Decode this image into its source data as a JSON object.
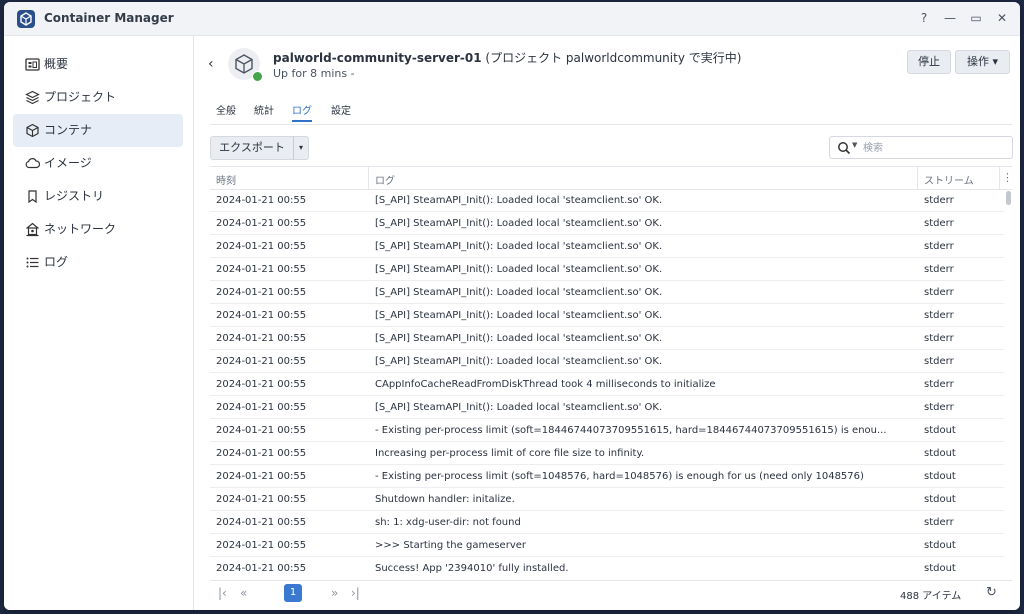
{
  "app": {
    "title": "Container Manager"
  },
  "window_controls": {
    "help": "?",
    "minimize": "—",
    "maximize": "▭",
    "close": "✕"
  },
  "sidebar": {
    "items": [
      {
        "label": "概要",
        "icon": "overview-icon"
      },
      {
        "label": "プロジェクト",
        "icon": "project-icon"
      },
      {
        "label": "コンテナ",
        "icon": "container-icon",
        "active": true
      },
      {
        "label": "イメージ",
        "icon": "image-icon"
      },
      {
        "label": "レジストリ",
        "icon": "registry-icon"
      },
      {
        "label": "ネットワーク",
        "icon": "network-icon"
      },
      {
        "label": "ログ",
        "icon": "log-icon"
      }
    ]
  },
  "container": {
    "name": "palworld-community-server-01",
    "project_note": " (プロジェクト palworldcommunity で実行中)",
    "uptime": "Up for 8 mins -",
    "status_color": "#45a54b"
  },
  "header_buttons": {
    "stop": "停止",
    "actions": "操作 ▾"
  },
  "tabs": [
    "全般",
    "統計",
    "ログ",
    "設定"
  ],
  "active_tab": "ログ",
  "toolbar": {
    "export": "エクスポート",
    "export_dropdown": "▾",
    "search_placeholder": "検索"
  },
  "table": {
    "headers": {
      "time": "時刻",
      "log": "ログ",
      "stream": "ストリーム",
      "menu": "⋮"
    },
    "rows": [
      {
        "time": "2024-01-21 00:55",
        "log": "[S_API] SteamAPI_Init(): Loaded local 'steamclient.so' OK.",
        "stream": "stderr"
      },
      {
        "time": "2024-01-21 00:55",
        "log": "[S_API] SteamAPI_Init(): Loaded local 'steamclient.so' OK.",
        "stream": "stderr"
      },
      {
        "time": "2024-01-21 00:55",
        "log": "[S_API] SteamAPI_Init(): Loaded local 'steamclient.so' OK.",
        "stream": "stderr"
      },
      {
        "time": "2024-01-21 00:55",
        "log": "[S_API] SteamAPI_Init(): Loaded local 'steamclient.so' OK.",
        "stream": "stderr"
      },
      {
        "time": "2024-01-21 00:55",
        "log": "[S_API] SteamAPI_Init(): Loaded local 'steamclient.so' OK.",
        "stream": "stderr"
      },
      {
        "time": "2024-01-21 00:55",
        "log": "[S_API] SteamAPI_Init(): Loaded local 'steamclient.so' OK.",
        "stream": "stderr"
      },
      {
        "time": "2024-01-21 00:55",
        "log": "[S_API] SteamAPI_Init(): Loaded local 'steamclient.so' OK.",
        "stream": "stderr"
      },
      {
        "time": "2024-01-21 00:55",
        "log": "[S_API] SteamAPI_Init(): Loaded local 'steamclient.so' OK.",
        "stream": "stderr"
      },
      {
        "time": "2024-01-21 00:55",
        "log": "CAppInfoCacheReadFromDiskThread took 4 milliseconds to initialize",
        "stream": "stderr"
      },
      {
        "time": "2024-01-21 00:55",
        "log": "[S_API] SteamAPI_Init(): Loaded local 'steamclient.so' OK.",
        "stream": "stderr"
      },
      {
        "time": "2024-01-21 00:55",
        "log": "- Existing per-process limit (soft=18446744073709551615, hard=18446744073709551615) is enou...",
        "stream": "stdout"
      },
      {
        "time": "2024-01-21 00:55",
        "log": "Increasing per-process limit of core file size to infinity.",
        "stream": "stdout"
      },
      {
        "time": "2024-01-21 00:55",
        "log": "- Existing per-process limit (soft=1048576, hard=1048576) is enough for us (need only 1048576)",
        "stream": "stdout"
      },
      {
        "time": "2024-01-21 00:55",
        "log": "Shutdown handler: initalize.",
        "stream": "stdout"
      },
      {
        "time": "2024-01-21 00:55",
        "log": "sh: 1: xdg-user-dir: not found",
        "stream": "stderr"
      },
      {
        "time": "2024-01-21 00:55",
        "log": ">>> Starting the gameserver",
        "stream": "stdout"
      },
      {
        "time": "2024-01-21 00:55",
        "log": "Success! App '2394010' fully installed.",
        "stream": "stdout"
      }
    ]
  },
  "pager": {
    "first": "|‹",
    "prev": "«",
    "page": "1",
    "next": "»",
    "last": "›|",
    "count": "488 アイテム",
    "refresh": "↻"
  },
  "colors": {
    "accent": "#2f72c8",
    "active_bg": "#e6edf7",
    "page_active": "#3a79cf"
  }
}
